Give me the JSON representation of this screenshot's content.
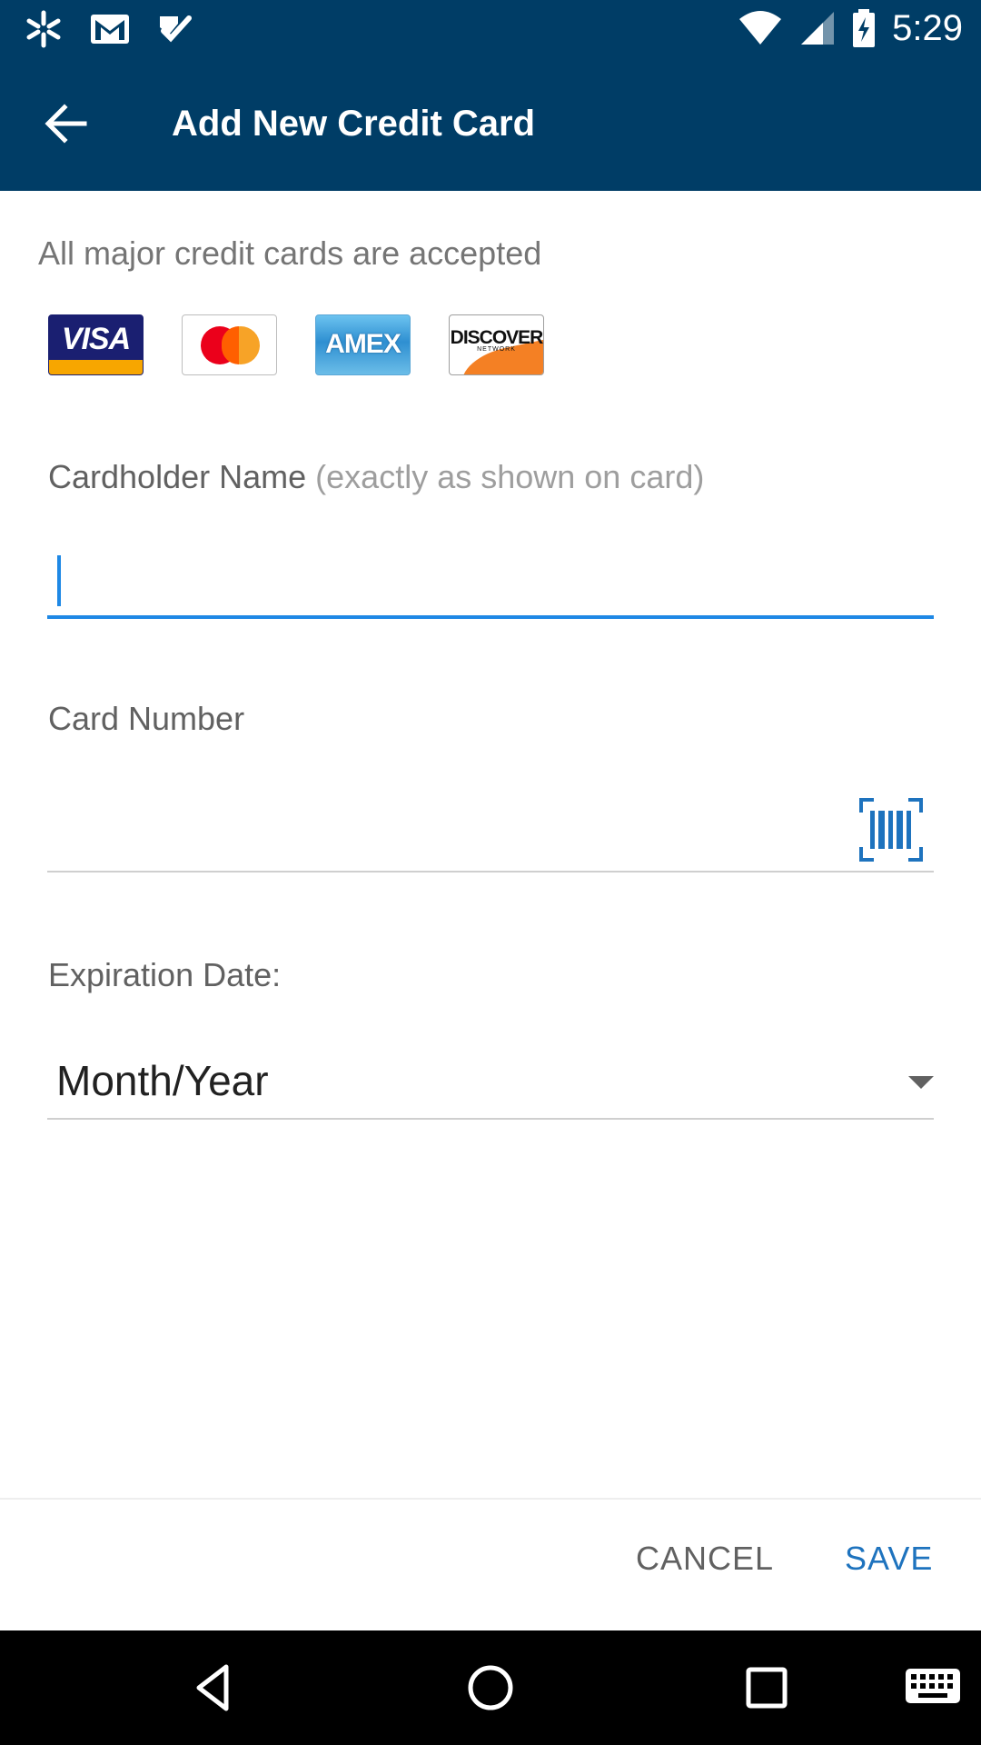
{
  "status_bar": {
    "time": "5:29",
    "left_icons": [
      "walmart-spark-icon",
      "gmail-icon",
      "tasks-check-icon"
    ],
    "right_icons": [
      "wifi-icon",
      "cell-signal-icon",
      "battery-charging-icon"
    ]
  },
  "app_bar": {
    "title": "Add New Credit Card",
    "back_icon": "arrow-back-icon"
  },
  "accepted_text": "All major credit cards are accepted",
  "card_logos": {
    "visa": "VISA",
    "mastercard": "",
    "amex": "AMEX",
    "discover": "DISCOVER",
    "discover_sub": "NETWORK"
  },
  "cardholder_field": {
    "label": "Cardholder Name",
    "hint": "(exactly as shown on card)",
    "value": ""
  },
  "card_number_field": {
    "label": "Card Number",
    "value": "",
    "scan_icon": "barcode-scan-icon"
  },
  "expiration_field": {
    "label": "Expiration Date:",
    "value": "Month/Year"
  },
  "actions": {
    "cancel_label": "CANCEL",
    "save_label": "SAVE"
  },
  "colors": {
    "primary": "#003d66",
    "accent": "#1e88e5",
    "save": "#1e73be"
  },
  "nav_bar": {
    "icons": [
      "nav-back-icon",
      "nav-home-icon",
      "nav-recents-icon",
      "keyboard-icon"
    ]
  }
}
